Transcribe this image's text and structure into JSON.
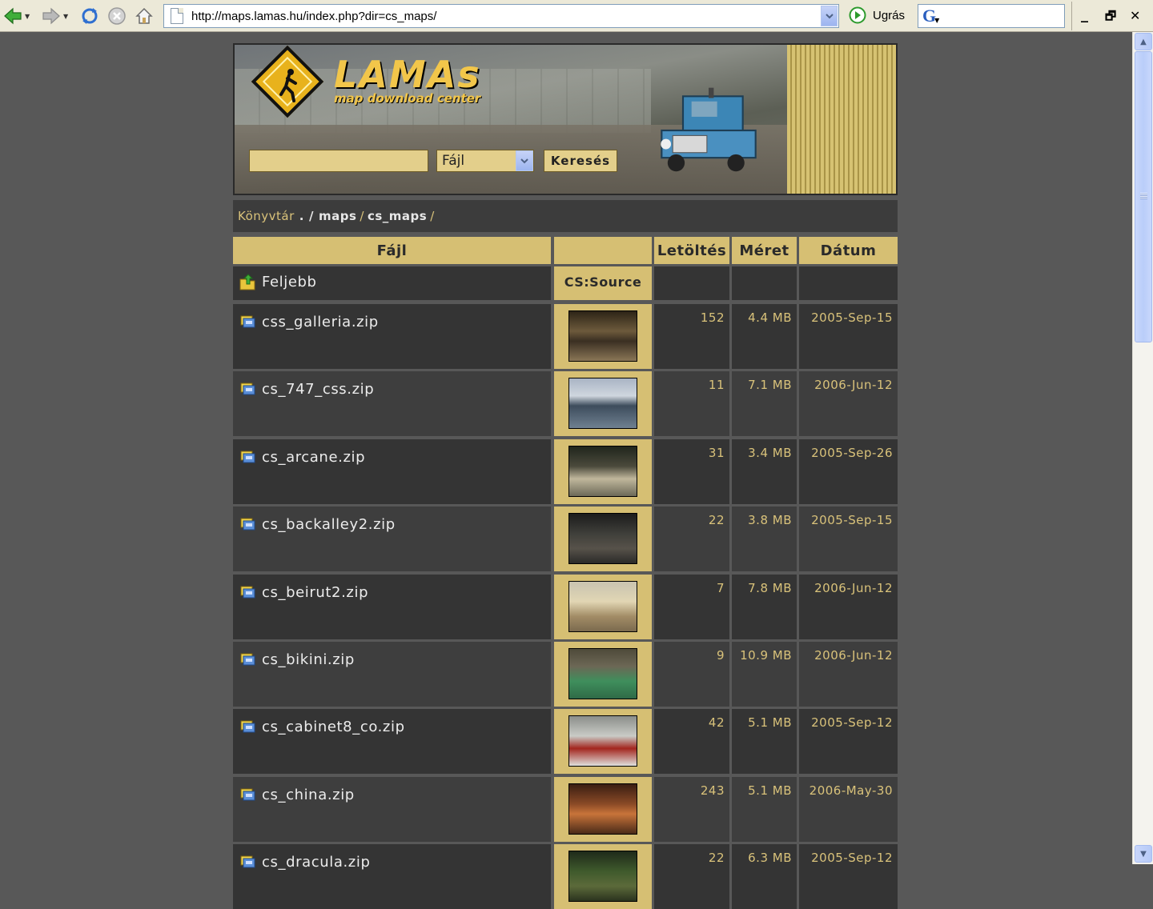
{
  "browser": {
    "url": "http://maps.lamas.hu/index.php?dir=cs_maps/",
    "go_label": "Ugrás",
    "minimize": "_",
    "restore": "🗗",
    "close": "✕"
  },
  "banner": {
    "title": "LAMAs",
    "subtitle": "map download center",
    "search_value": "",
    "search_type": "Fájl",
    "search_button": "Keresés"
  },
  "breadcrumb": {
    "root": "Könyvtár",
    "dot": ".",
    "items": [
      "maps",
      "cs_maps"
    ]
  },
  "table": {
    "headers": {
      "file": "Fájl",
      "thumb": "",
      "downloads": "Letöltés",
      "size": "Méret",
      "date": "Dátum"
    },
    "updir": {
      "label": "Feljebb",
      "category": "CS:Source"
    },
    "rows": [
      {
        "name": "css_galleria.zip",
        "downloads": "152",
        "size": "4.4 MB",
        "date": "2005-Sep-15"
      },
      {
        "name": "cs_747_css.zip",
        "downloads": "11",
        "size": "7.1 MB",
        "date": "2006-Jun-12"
      },
      {
        "name": "cs_arcane.zip",
        "downloads": "31",
        "size": "3.4 MB",
        "date": "2005-Sep-26"
      },
      {
        "name": "cs_backalley2.zip",
        "downloads": "22",
        "size": "3.8 MB",
        "date": "2005-Sep-15"
      },
      {
        "name": "cs_beirut2.zip",
        "downloads": "7",
        "size": "7.8 MB",
        "date": "2006-Jun-12"
      },
      {
        "name": "cs_bikini.zip",
        "downloads": "9",
        "size": "10.9 MB",
        "date": "2006-Jun-12"
      },
      {
        "name": "cs_cabinet8_co.zip",
        "downloads": "42",
        "size": "5.1 MB",
        "date": "2005-Sep-12"
      },
      {
        "name": "cs_china.zip",
        "downloads": "243",
        "size": "5.1 MB",
        "date": "2006-May-30"
      },
      {
        "name": "cs_dracula.zip",
        "downloads": "22",
        "size": "6.3 MB",
        "date": "2005-Sep-12"
      }
    ]
  }
}
